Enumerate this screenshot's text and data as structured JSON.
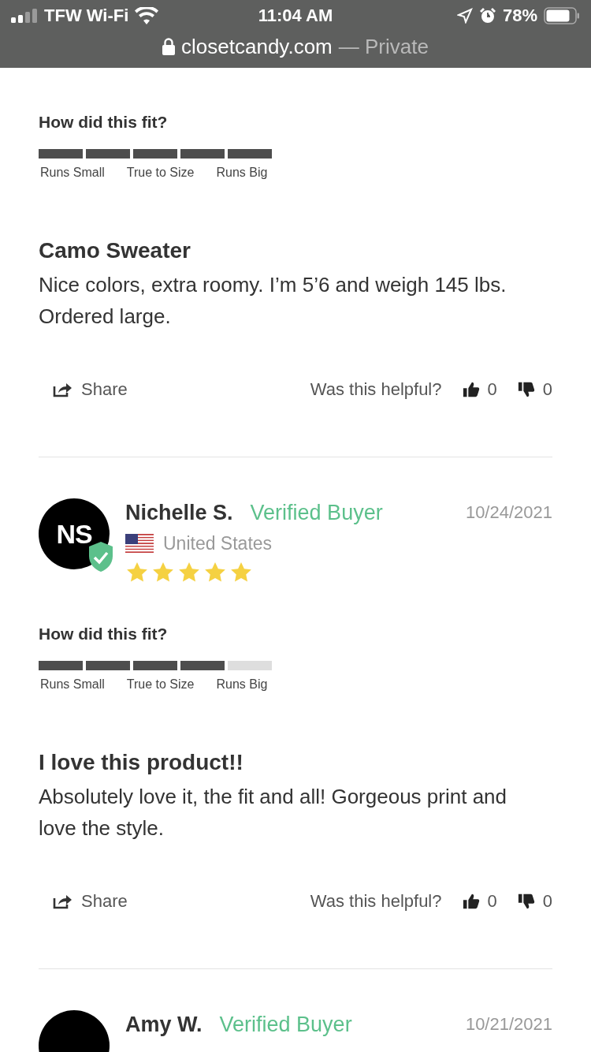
{
  "status_bar": {
    "carrier": "TFW Wi-Fi",
    "time": "11:04 AM",
    "battery": "78%"
  },
  "address_bar": {
    "domain": "closetcandy.com",
    "suffix": "— Private"
  },
  "reviews": [
    {
      "fit": {
        "question": "How did this fit?",
        "level": 1,
        "labels": [
          "Runs Small",
          "True to Size",
          "Runs Big"
        ]
      },
      "title": "Camo Sweater",
      "body": "Nice colors, extra roomy. I’m 5’6 and weigh 145 lbs. Ordered large.",
      "share": "Share",
      "helpful": {
        "question": "Was this helpful?",
        "up": "0",
        "down": "0"
      }
    },
    {
      "initials": "NS",
      "name": "Nichelle S.",
      "verified": "Verified Buyer",
      "date": "10/24/2021",
      "country": "United States",
      "stars": 5,
      "fit": {
        "question": "How did this fit?",
        "level": 0.8,
        "labels": [
          "Runs Small",
          "True to Size",
          "Runs Big"
        ]
      },
      "title": "I love this product!!",
      "body": "Absolutely love it, the fit and all! Gorgeous print and love the style.",
      "share": "Share",
      "helpful": {
        "question": "Was this helpful?",
        "up": "0",
        "down": "0"
      }
    },
    {
      "name": "Amy W.",
      "verified": "Verified Buyer",
      "date": "10/21/2021"
    }
  ]
}
